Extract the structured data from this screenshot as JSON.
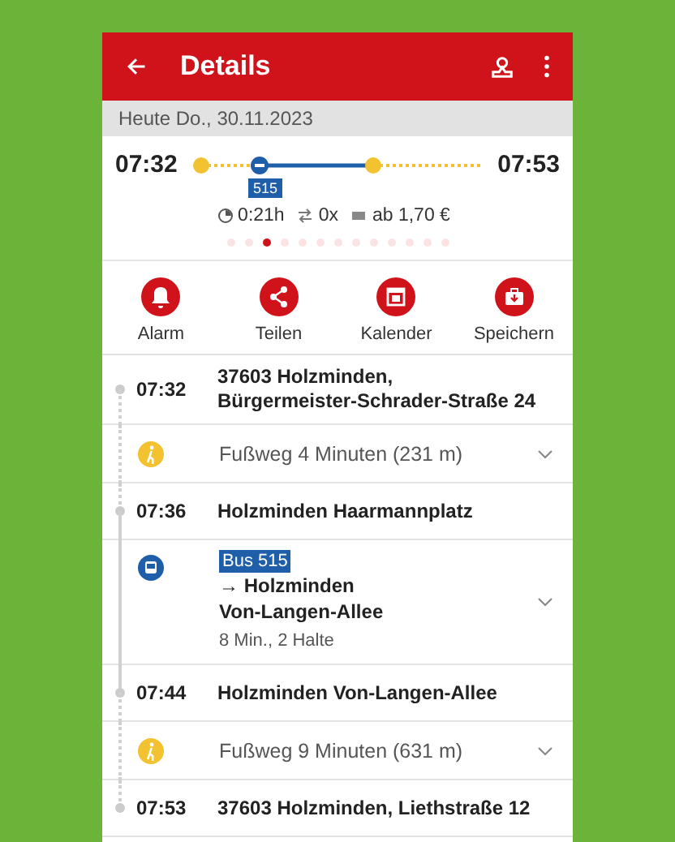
{
  "header": {
    "title": "Details"
  },
  "date_bar": "Heute Do., 30.11.2023",
  "summary": {
    "departure": "07:32",
    "arrival": "07:53",
    "line_badge": "515",
    "duration": "0:21h",
    "transfers": "0x",
    "price": "ab 1,70 €"
  },
  "page_dots": [
    {
      "selected": false
    },
    {
      "selected": false
    },
    {
      "selected": true
    },
    {
      "selected": false
    },
    {
      "selected": false
    },
    {
      "selected": false
    },
    {
      "selected": false
    },
    {
      "selected": false
    },
    {
      "selected": false
    },
    {
      "selected": false
    },
    {
      "selected": false
    },
    {
      "selected": false
    },
    {
      "selected": false
    }
  ],
  "actions": [
    {
      "kind": "alarm",
      "label": "Alarm"
    },
    {
      "kind": "share",
      "label": "Teilen"
    },
    {
      "kind": "calendar",
      "label": "Kalender"
    },
    {
      "kind": "save",
      "label": "Speichern"
    }
  ],
  "itinerary": [
    {
      "kind": "stop",
      "time": "07:32",
      "lines": [
        "37603 Holzminden,",
        "Bürgermeister-Schrader-Straße 24"
      ]
    },
    {
      "kind": "walk",
      "text": "Fußweg 4 Minuten (231 m)"
    },
    {
      "kind": "stop",
      "time": "07:36",
      "lines": [
        "Holzminden Haarmannplatz"
      ]
    },
    {
      "kind": "ride",
      "badge": "Bus 515",
      "direction": [
        "→ Holzminden",
        "Von-Langen-Allee"
      ],
      "info": "8 Min., 2 Halte"
    },
    {
      "kind": "stop",
      "time": "07:44",
      "lines": [
        "Holzminden Von-Langen-Allee"
      ]
    },
    {
      "kind": "walk",
      "text": "Fußweg 9 Minuten (631 m)"
    },
    {
      "kind": "stop",
      "time": "07:53",
      "lines": [
        "37603 Holzminden, Liethstraße 12"
      ]
    }
  ]
}
